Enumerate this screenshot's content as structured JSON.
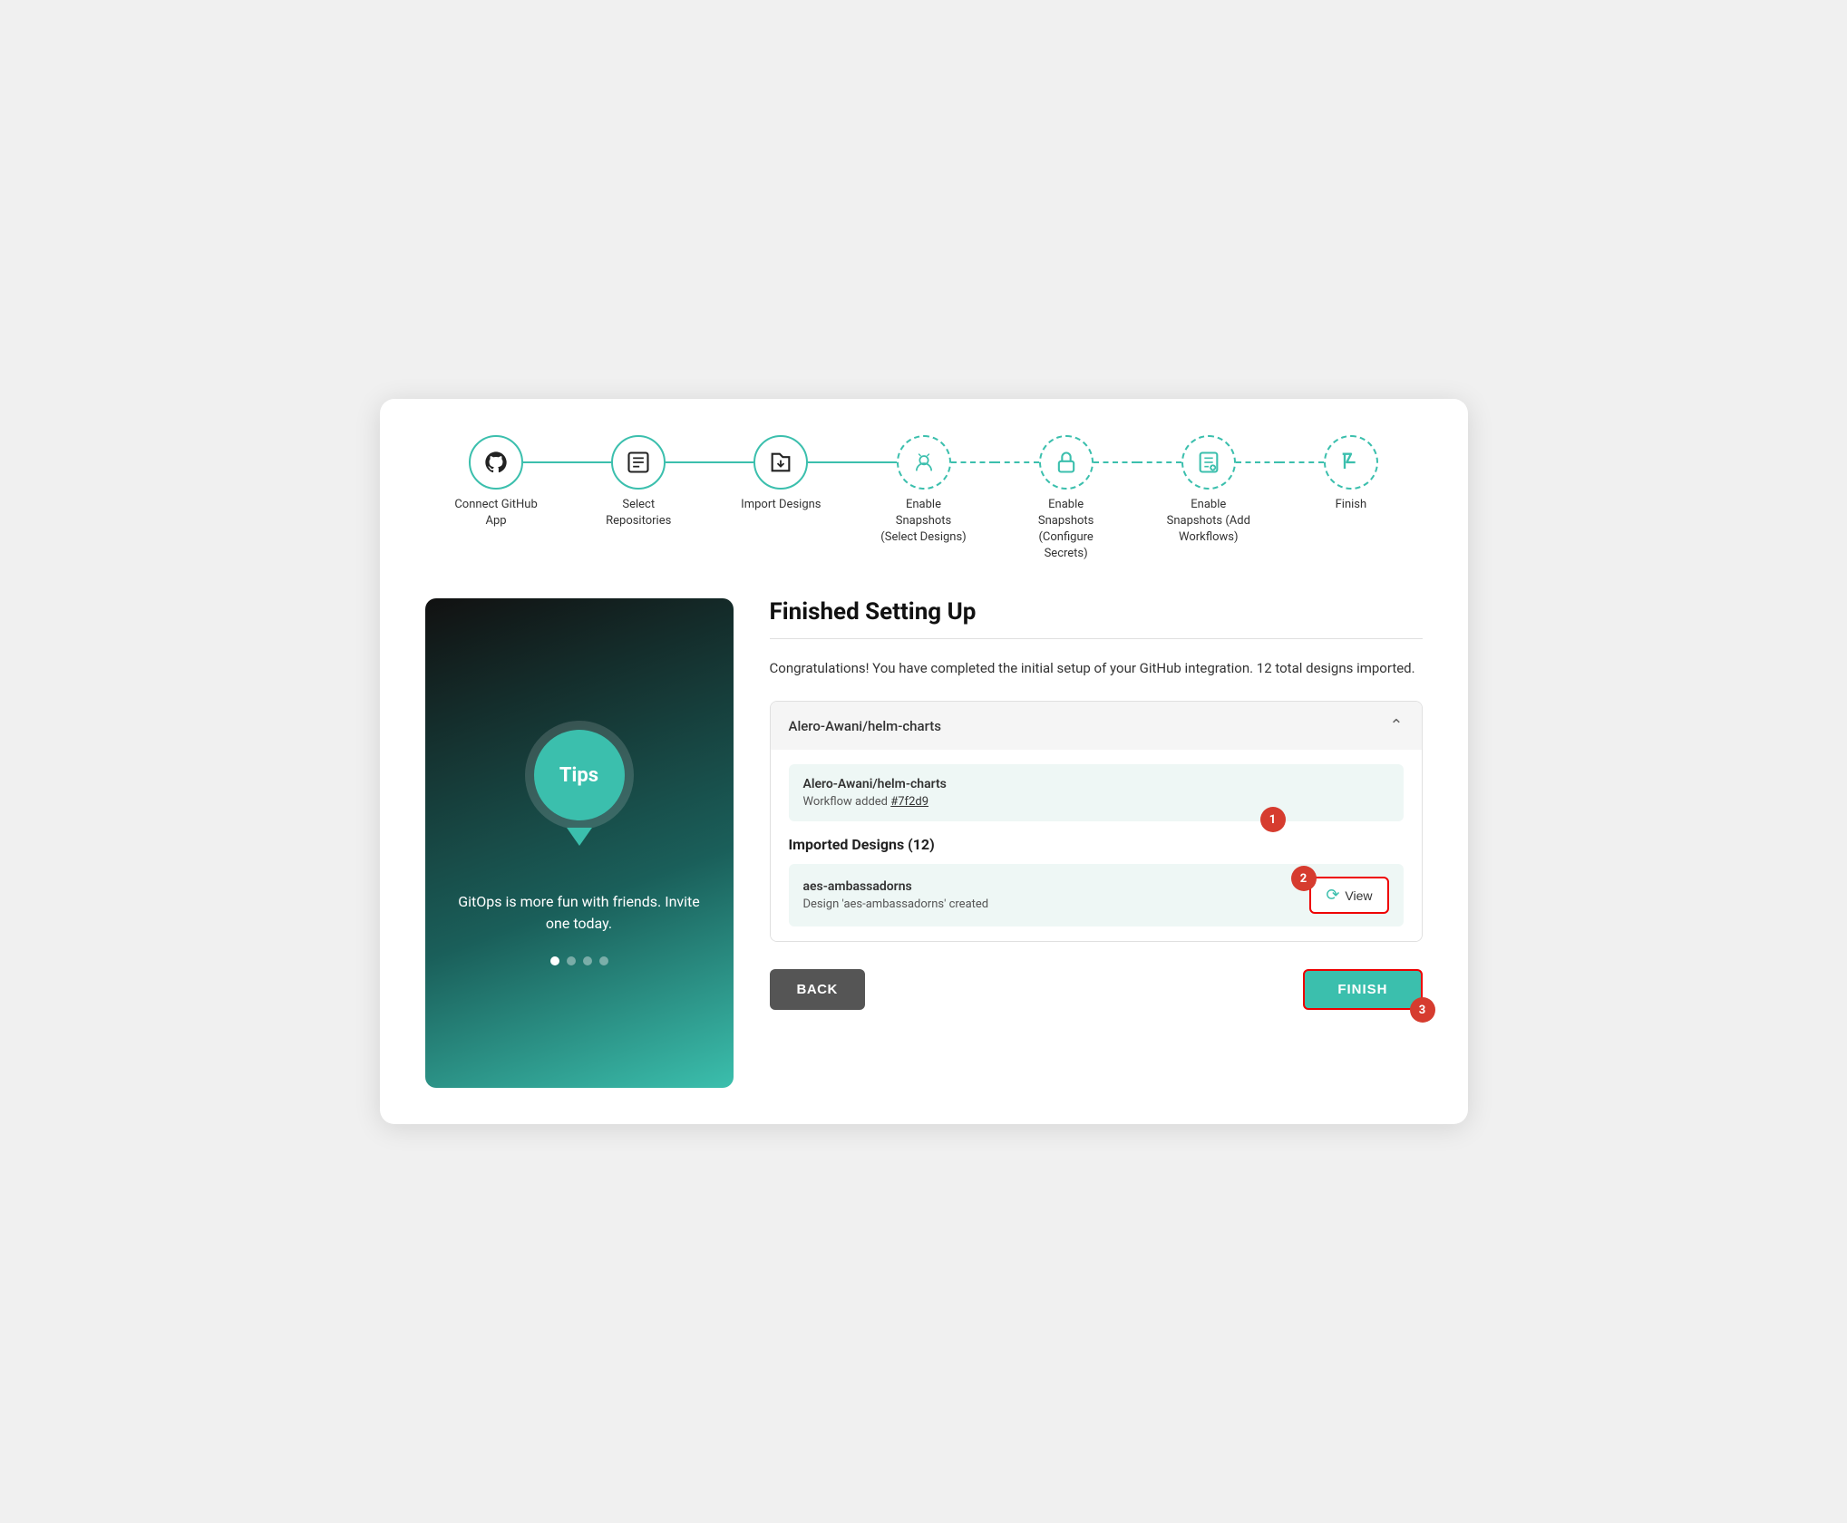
{
  "stepper": {
    "steps": [
      {
        "id": "connect-github",
        "label": "Connect GitHub\nApp",
        "style": "solid",
        "icon": "github"
      },
      {
        "id": "select-repos",
        "label": "Select\nRepositories",
        "style": "solid",
        "icon": "repos"
      },
      {
        "id": "import-designs",
        "label": "Import Designs",
        "style": "solid",
        "icon": "import"
      },
      {
        "id": "enable-snapshots-select",
        "label": "Enable\nSnapshots\n(Select Designs)",
        "style": "dashed",
        "icon": "snapshots"
      },
      {
        "id": "enable-snapshots-configure",
        "label": "Enable\nSnapshots\n(Configure\nSecrets)",
        "style": "dashed",
        "icon": "lock"
      },
      {
        "id": "enable-snapshots-add",
        "label": "Enable\nSnapshots (Add\nWorkflows)",
        "style": "dashed",
        "icon": "doc"
      },
      {
        "id": "finish",
        "label": "Finish",
        "style": "dashed",
        "icon": "flag"
      }
    ]
  },
  "tips": {
    "title": "Tips",
    "text": "GitOps is more fun with friends. Invite one today.",
    "dots": [
      true,
      false,
      false,
      false
    ]
  },
  "main": {
    "heading": "Finished Setting Up",
    "congrats": "Congratulations! You have completed the initial setup of your GitHub integration. 12 total designs imported.",
    "accordion": {
      "repo_label": "Alero-Awani/helm-charts",
      "workflow": {
        "repo": "Alero-Awani/helm-charts",
        "info": "Workflow added",
        "link_text": "#7f2d9",
        "link_url": "#"
      },
      "imported_section_label": "Imported Designs (12)",
      "designs": [
        {
          "name": "aes-ambassadorns",
          "status": "Design 'aes-ambassadorns' created",
          "view_label": "View"
        }
      ]
    },
    "badges": [
      "1",
      "2",
      "3"
    ],
    "back_label": "BACK",
    "finish_label": "FINISH"
  }
}
